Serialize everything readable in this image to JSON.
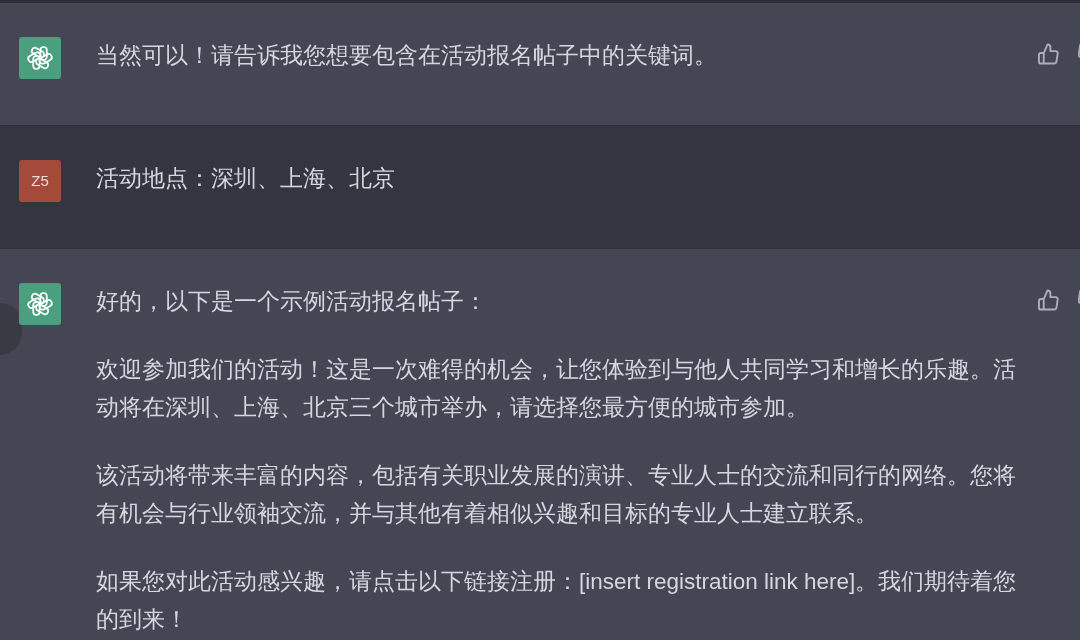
{
  "messages": [
    {
      "kind": "assistant",
      "paragraphs": [
        "当然可以！请告诉我您想要包含在活动报名帖子中的关键词。"
      ]
    },
    {
      "kind": "user",
      "avatar_text": "Z5",
      "paragraphs": [
        "活动地点：深圳、上海、北京"
      ]
    },
    {
      "kind": "assistant",
      "paragraphs": [
        "好的，以下是一个示例活动报名帖子：",
        "欢迎参加我们的活动！这是一次难得的机会，让您体验到与他人共同学习和增长的乐趣。活动将在深圳、上海、北京三个城市举办，请选择您最方便的城市参加。",
        "该活动将带来丰富的内容，包括有关职业发展的演讲、专业人士的交流和同行的网络。您将有机会与行业领袖交流，并与其他有着相似兴趣和目标的专业人士建立联系。",
        "如果您对此活动感兴趣，请点击以下链接注册：[insert registration link here]。我们期待着您的到来！"
      ]
    }
  ]
}
